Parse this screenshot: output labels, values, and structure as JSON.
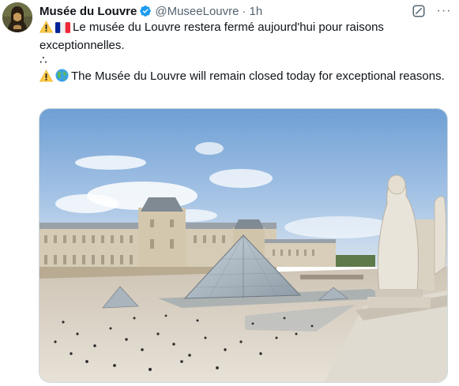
{
  "tweet": {
    "author_name": "Musée du Louvre",
    "handle": "@MuseeLouvre",
    "separator": "·",
    "time": "1h",
    "line1_fr": "Le musée du Louvre restera fermé aujourd'hui pour raisons exceptionnelles.",
    "line2_dots": "∴",
    "line3_en": "The Musée du Louvre will remain closed today for exceptional reasons."
  },
  "icons": {
    "verified": "verified-badge-icon",
    "grok": "grok-icon",
    "more": "more-icon",
    "warning": "warning-emoji",
    "flag": "france-flag-emoji",
    "globe": "globe-emoji"
  },
  "ui": {
    "more_label": "···"
  },
  "colors": {
    "text": "#0f1419",
    "secondary": "#536471",
    "verified": "#1d9bf0",
    "border": "#cfd9de"
  },
  "media": {
    "alt": "Louvre courtyard with glass pyramid"
  }
}
